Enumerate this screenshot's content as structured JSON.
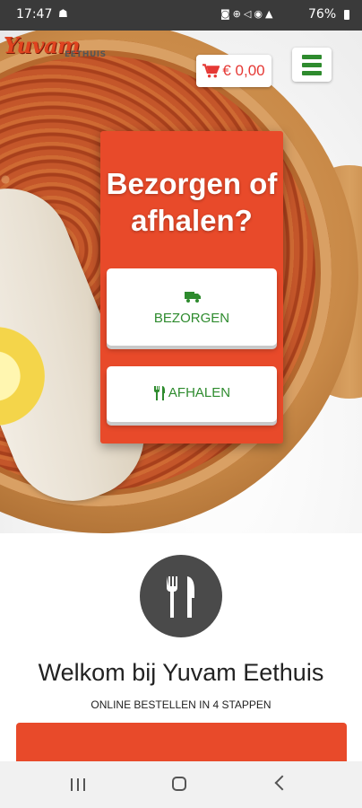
{
  "status_bar": {
    "time": "17:47",
    "battery": "76%"
  },
  "header": {
    "logo_name": "Yuvam",
    "logo_sub": "EETHUIS",
    "cart_amount": "€ 0,00"
  },
  "modal": {
    "title": "Bezorgen of afhalen?",
    "deliver_label": "BEZORGEN",
    "pickup_label": "AFHALEN"
  },
  "welcome": {
    "title": "Welkom bij Yuvam Eethuis",
    "subtitle": "ONLINE BESTELLEN IN 4 STAPPEN"
  },
  "colors": {
    "brand_red": "#e84a2a",
    "accent_green": "#2e8b2e",
    "cart_red": "#e53935"
  },
  "icons": [
    "cart-icon",
    "menu-icon",
    "truck-icon",
    "cutlery-icon",
    "fork-knife-icon"
  ]
}
